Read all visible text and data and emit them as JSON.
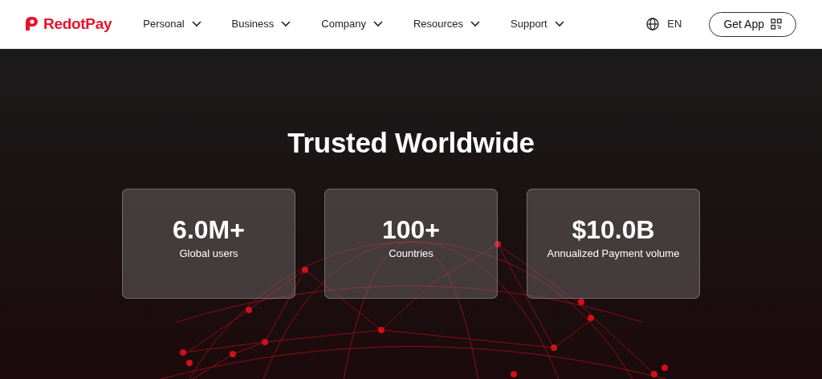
{
  "header": {
    "brand": "RedotPay",
    "nav": [
      {
        "label": "Personal"
      },
      {
        "label": "Business"
      },
      {
        "label": "Company"
      },
      {
        "label": "Resources"
      },
      {
        "label": "Support"
      }
    ],
    "language": "EN",
    "cta": "Get App"
  },
  "hero": {
    "title": "Trusted Worldwide",
    "stats": [
      {
        "value": "6.0M+",
        "label": "Global users"
      },
      {
        "value": "100+",
        "label": "Countries"
      },
      {
        "value": "$10.0B",
        "label": "Annualized Payment volume"
      }
    ]
  }
}
